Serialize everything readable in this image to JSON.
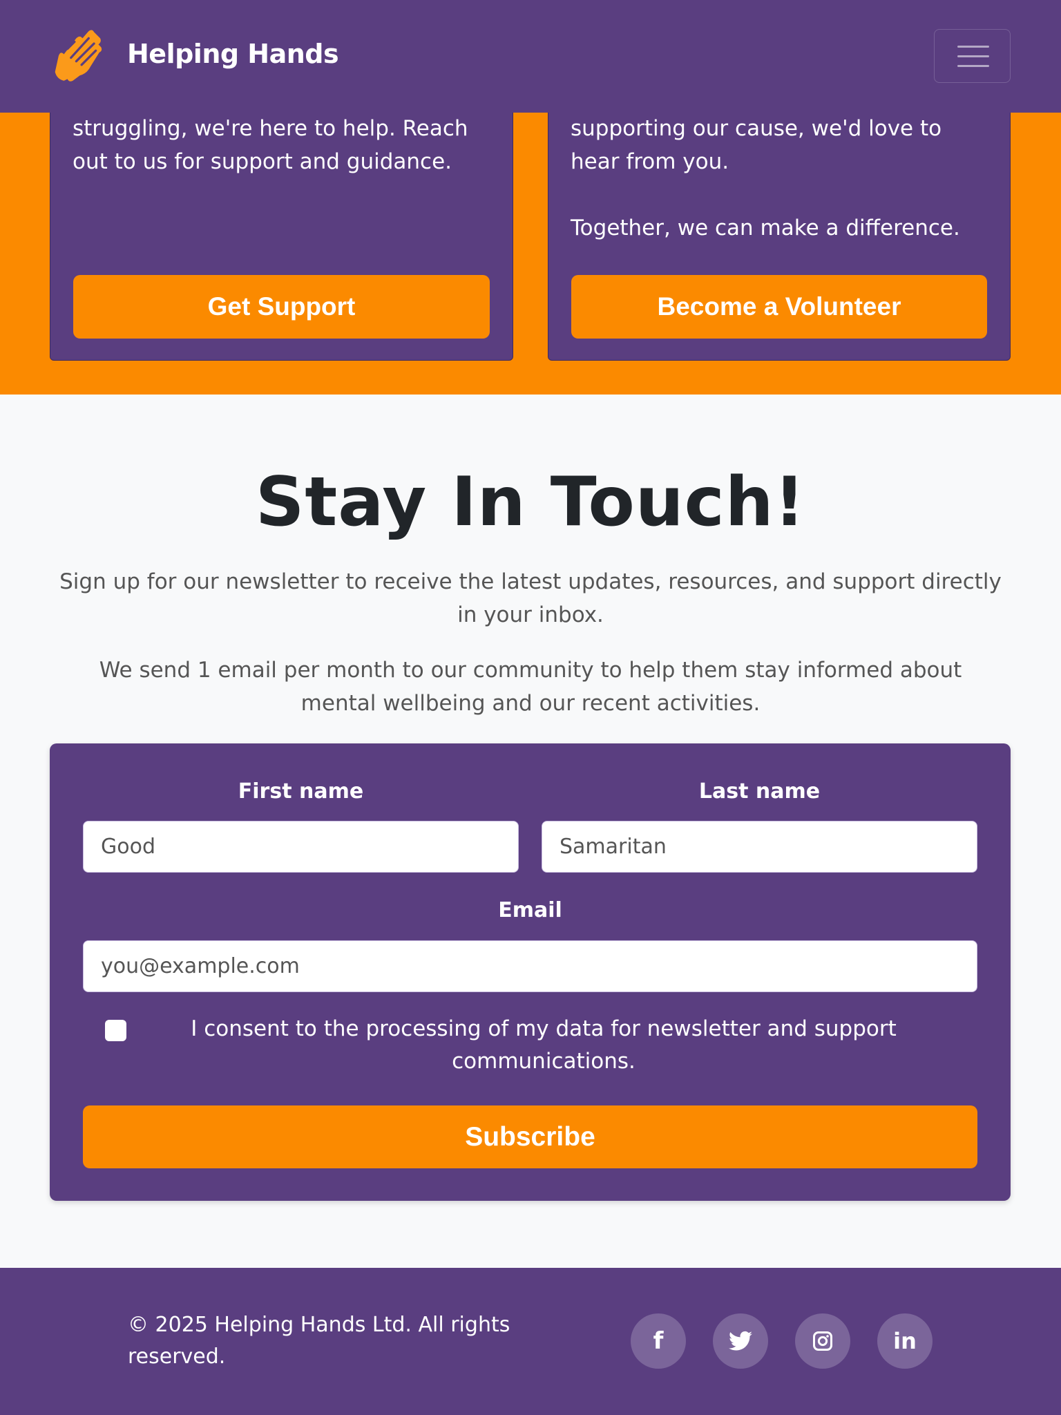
{
  "header": {
    "brand": "Helping Hands",
    "logo_icon": "clapping-hands-icon",
    "menu_icon": "hamburger-menu-icon"
  },
  "hero": {
    "cards": [
      {
        "text": "struggling, we're here to help. Reach out to us for support and guidance.",
        "button": "Get Support"
      },
      {
        "text": "supporting our cause, we'd love to hear from you.",
        "text2": "Together, we can make a difference.",
        "button": "Become a Volunteer"
      }
    ]
  },
  "newsletter": {
    "title": "Stay In Touch!",
    "intro": "Sign up for our newsletter to receive the latest updates, resources, and support directly in your inbox.",
    "frequency": "We send 1 email per month to our community to help them stay informed about mental wellbeing and our recent activities.",
    "form": {
      "first_name_label": "First name",
      "first_name_value": "Good",
      "last_name_label": "Last name",
      "last_name_value": "Samaritan",
      "email_label": "Email",
      "email_placeholder": "you@example.com",
      "consent": "I consent to the processing of my data for newsletter and support communications.",
      "consent_checked": false,
      "submit": "Subscribe"
    }
  },
  "footer": {
    "copyright": "© 2025 Helping Hands Ltd. All rights reserved.",
    "social": [
      "facebook",
      "twitter",
      "instagram",
      "linkedin"
    ]
  },
  "colors": {
    "purple": "#5a3e80",
    "orange": "#fb8a00"
  }
}
